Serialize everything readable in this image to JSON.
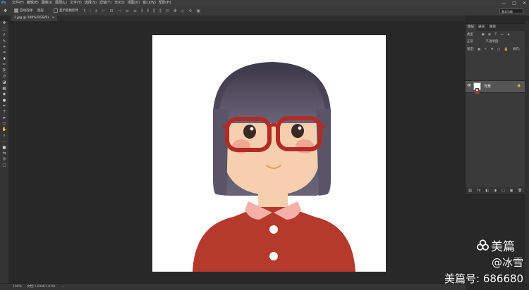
{
  "app": {
    "logo": "Ps"
  },
  "menu": {
    "items": [
      "文件(F)",
      "编辑(E)",
      "图像(I)",
      "图层(L)",
      "文字(Y)",
      "选择(S)",
      "滤镜(T)",
      "3D(D)",
      "视图(V)",
      "窗口(W)",
      "帮助(H)"
    ]
  },
  "window_controls": {
    "minimize": "—",
    "maximize": "□",
    "close": "✕"
  },
  "options": {
    "auto_select_label": "自动选择:",
    "auto_select_target": "图层",
    "transform_label": "显示变换控件",
    "search_placeholder": "基本功能"
  },
  "tabs": [
    {
      "label": "1.jpg @ 100%(RGB/8)",
      "close": "×"
    }
  ],
  "tools": [
    "move-icon",
    "marquee-icon",
    "lasso-icon",
    "quick-select-icon",
    "crop-icon",
    "eyedropper-icon",
    "healing-icon",
    "brush-icon",
    "stamp-icon",
    "history-brush-icon",
    "eraser-icon",
    "gradient-icon",
    "blur-icon",
    "dodge-icon",
    "pen-icon",
    "text-icon",
    "path-select-icon",
    "shape-icon",
    "hand-icon",
    "zoom-icon",
    "more-icon",
    "colors-icon",
    "swap-icon",
    "quickmask-icon",
    "screenmode-icon"
  ],
  "tool_glyphs": [
    "✥",
    "⬚",
    "ℓ",
    "✎",
    "⌗",
    "✑",
    "✚",
    "✏",
    "⎘",
    "↺",
    "◪",
    "▦",
    "◆",
    "●",
    "✒",
    "T",
    "➤",
    "▭",
    "✋",
    "⌕",
    "…",
    "■",
    "⇆",
    "◎",
    "▢"
  ],
  "status": {
    "zoom": "100%",
    "doc": "文档:1.01M/1.01M",
    "arrow": "›"
  },
  "layers_panel": {
    "tabs": [
      "图层",
      "通道",
      "路径"
    ],
    "kind_label": "类型",
    "blend_mode": "正常",
    "opacity_label": "不透明度:",
    "lock_label": "锁定:",
    "fill_label": "填充:",
    "layer_name": "背景",
    "eye": "👁",
    "lock": "🔒",
    "footer_icons": [
      "⛓",
      "fx",
      "◧",
      "◑",
      "▢",
      "▣",
      "🗑"
    ]
  },
  "watermark": {
    "brand": "美篇",
    "user": "@冰雪",
    "id": "美篇号: 686680"
  },
  "colors": {
    "hair": "#4a4658",
    "skin": "#f5cfae",
    "shirt": "#b53a2b",
    "collar": "#f7b0a8",
    "glasses": "#b22b26",
    "blush": "#f2a591"
  }
}
